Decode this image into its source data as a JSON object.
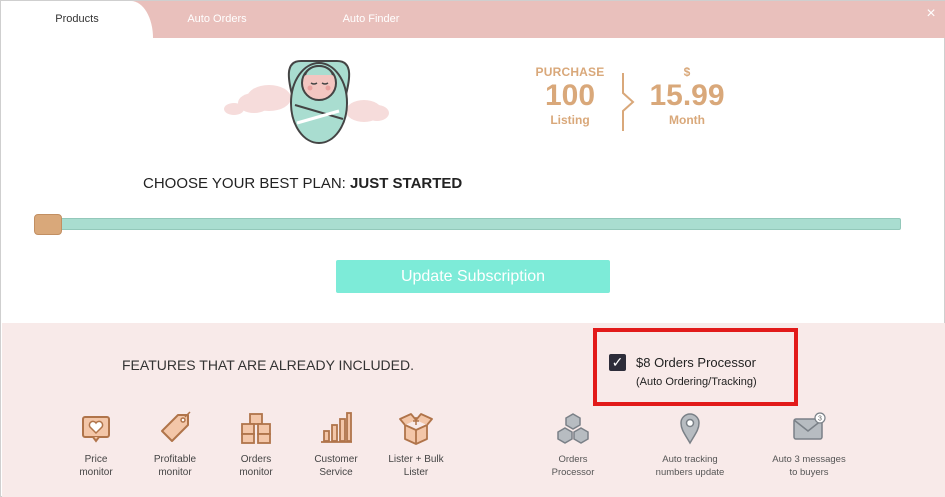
{
  "tabs": [
    {
      "label": "Products",
      "active": true
    },
    {
      "label": "Auto Orders",
      "active": false
    },
    {
      "label": "Auto Finder",
      "active": false
    }
  ],
  "close_icon": "×",
  "price": {
    "purchase_label": "PURCHASE",
    "purchase_value": "100",
    "purchase_unit": "Listing",
    "currency_label": "$",
    "price_value": "15.99",
    "price_unit": "Month",
    "accent_color": "#d9a87a"
  },
  "plan": {
    "prefix": "CHOOSE YOUR BEST PLAN: ",
    "name": "JUST STARTED",
    "slider_position": 0
  },
  "update_button": "Update Subscription",
  "features": {
    "title": "FEATURES THAT ARE ALREADY INCLUDED.",
    "items": [
      {
        "label": "Price\nmonitor",
        "icon": "heart-card-icon"
      },
      {
        "label": "Profitable\nmonitor",
        "icon": "price-tag-icon"
      },
      {
        "label": "Orders\nmonitor",
        "icon": "boxes-icon"
      },
      {
        "label": "Customer\nService",
        "icon": "bar-chart-icon"
      },
      {
        "label": "Lister + Bulk\nLister",
        "icon": "open-box-icon"
      }
    ],
    "extra_items": [
      {
        "label": "Orders\nProcessor",
        "icon": "boxes-gray-icon"
      },
      {
        "label": "Auto tracking\nnumbers update",
        "icon": "location-pin-icon"
      },
      {
        "label": "Auto 3 messages\nto buyers",
        "icon": "envelope-icon"
      }
    ]
  },
  "processor": {
    "checked": true,
    "title": "$8 Orders Processor",
    "subtitle": "(Auto Ordering/Tracking)",
    "envelope_badge": "3"
  }
}
